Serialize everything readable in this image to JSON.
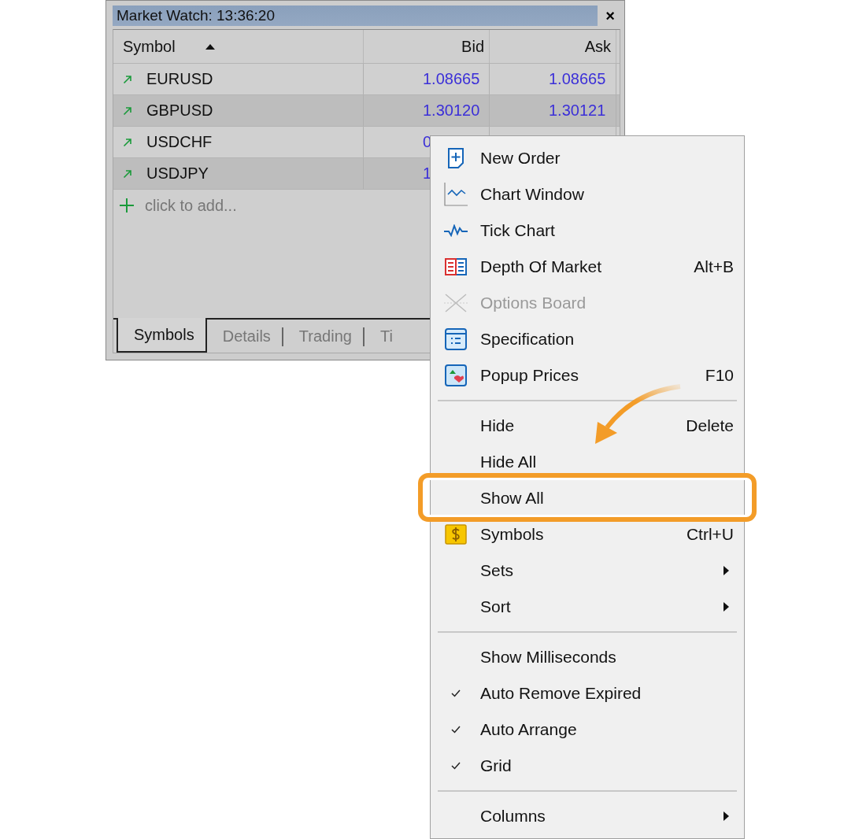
{
  "window": {
    "title": "Market Watch: 13:36:20",
    "close": "×"
  },
  "table": {
    "columns": [
      {
        "label": "Symbol",
        "sorted": true
      },
      {
        "label": "Bid",
        "sorted": false
      },
      {
        "label": "Ask",
        "sorted": false
      }
    ],
    "rows": [
      {
        "symbol": "EURUSD",
        "bid": "1.08665",
        "ask": "1.08665"
      },
      {
        "symbol": "GBPUSD",
        "bid": "1.30120",
        "ask": "1.30121"
      },
      {
        "symbol": "USDCHF",
        "bid": "0"
      },
      {
        "symbol": "USDJPY",
        "bid": "1"
      }
    ],
    "add_row": "click to add..."
  },
  "tabs": [
    {
      "label": "Symbols",
      "selected": true
    },
    {
      "label": "Details",
      "selected": false
    },
    {
      "label": "Trading",
      "selected": false
    },
    {
      "label": "Ti",
      "selected": false
    }
  ],
  "context_menu": {
    "sections": [
      [
        {
          "label": "New Order",
          "disabled": false
        },
        {
          "label": "Chart Window",
          "disabled": false
        },
        {
          "label": "Tick Chart",
          "disabled": false
        },
        {
          "label": "Depth Of Market",
          "shortcut": "Alt+B",
          "disabled": false
        },
        {
          "label": "Options Board",
          "disabled": true
        },
        {
          "label": "Specification",
          "disabled": false
        },
        {
          "label": "Popup Prices",
          "shortcut": "F10",
          "disabled": false
        }
      ],
      [
        {
          "label": "Hide",
          "shortcut": "Delete",
          "highlighted": false,
          "submenu": false
        },
        {
          "label": "Hide All",
          "highlighted": false,
          "submenu": false
        },
        {
          "label": "Show All",
          "highlighted": true,
          "submenu": false
        },
        {
          "label": "Symbols",
          "shortcut": "Ctrl+U",
          "highlighted": false,
          "submenu": false
        },
        {
          "label": "Sets",
          "highlighted": false,
          "submenu": true
        },
        {
          "label": "Sort",
          "highlighted": false,
          "submenu": true
        }
      ],
      [
        {
          "label": "Show Milliseconds",
          "checked": false
        },
        {
          "label": "Auto Remove Expired",
          "checked": true
        },
        {
          "label": "Auto Arrange",
          "checked": true
        },
        {
          "label": "Grid",
          "checked": true
        }
      ],
      [
        {
          "label": "Columns",
          "submenu": true
        }
      ]
    ]
  }
}
